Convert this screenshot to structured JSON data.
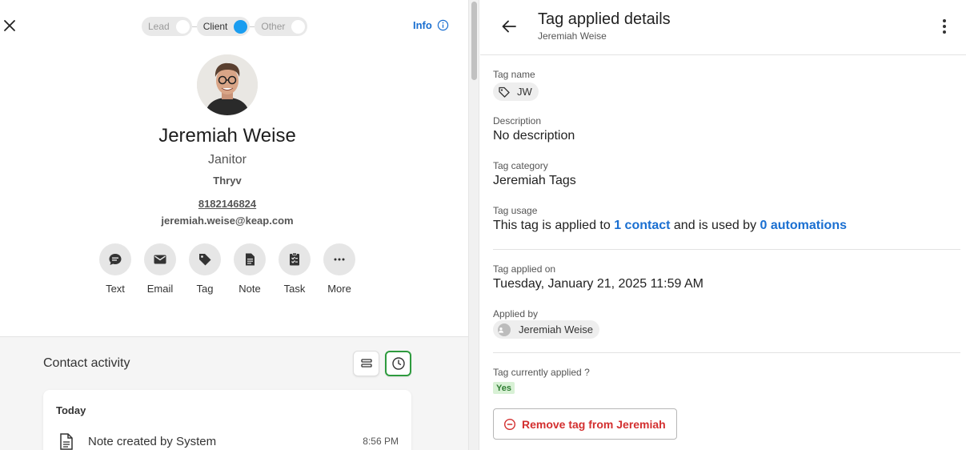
{
  "contact": {
    "stages": [
      "Lead",
      "Client",
      "Other"
    ],
    "active_stage": "Client",
    "info_label": "Info",
    "name": "Jeremiah Weise",
    "job_title": "Janitor",
    "company": "Thryv",
    "phone": "8182146824",
    "email": "jeremiah.weise@keap.com",
    "actions": [
      {
        "label": "Text",
        "icon": "chat-icon"
      },
      {
        "label": "Email",
        "icon": "mail-icon"
      },
      {
        "label": "Tag",
        "icon": "tag-icon"
      },
      {
        "label": "Note",
        "icon": "note-icon"
      },
      {
        "label": "Task",
        "icon": "task-icon"
      },
      {
        "label": "More",
        "icon": "more-horizontal-icon"
      }
    ]
  },
  "activity": {
    "title": "Contact activity",
    "day": "Today",
    "items": [
      {
        "text": "Note created by System",
        "time": "8:56 PM",
        "icon": "note-icon"
      }
    ]
  },
  "details": {
    "title": "Tag applied details",
    "subtitle": "Jeremiah Weise",
    "tag_name_label": "Tag name",
    "tag_name": "JW",
    "description_label": "Description",
    "description": "No description",
    "category_label": "Tag category",
    "category": "Jeremiah Tags",
    "usage_label": "Tag usage",
    "usage_prefix": "This tag is applied to ",
    "usage_contacts": "1 contact",
    "usage_middle": " and is used by ",
    "usage_automations": "0 automations",
    "applied_on_label": "Tag applied on",
    "applied_on": "Tuesday, January 21, 2025 11:59 AM",
    "applied_by_label": "Applied by",
    "applied_by": "Jeremiah Weise",
    "currently_applied_label": "Tag currently applied ?",
    "currently_applied": "Yes",
    "remove_button": "Remove tag from Jeremiah"
  },
  "colors": {
    "accent_blue": "#1a6fd1",
    "toggle_blue": "#1a9df0",
    "danger_red": "#d32f2f",
    "success_green": "#2e9b3e"
  }
}
